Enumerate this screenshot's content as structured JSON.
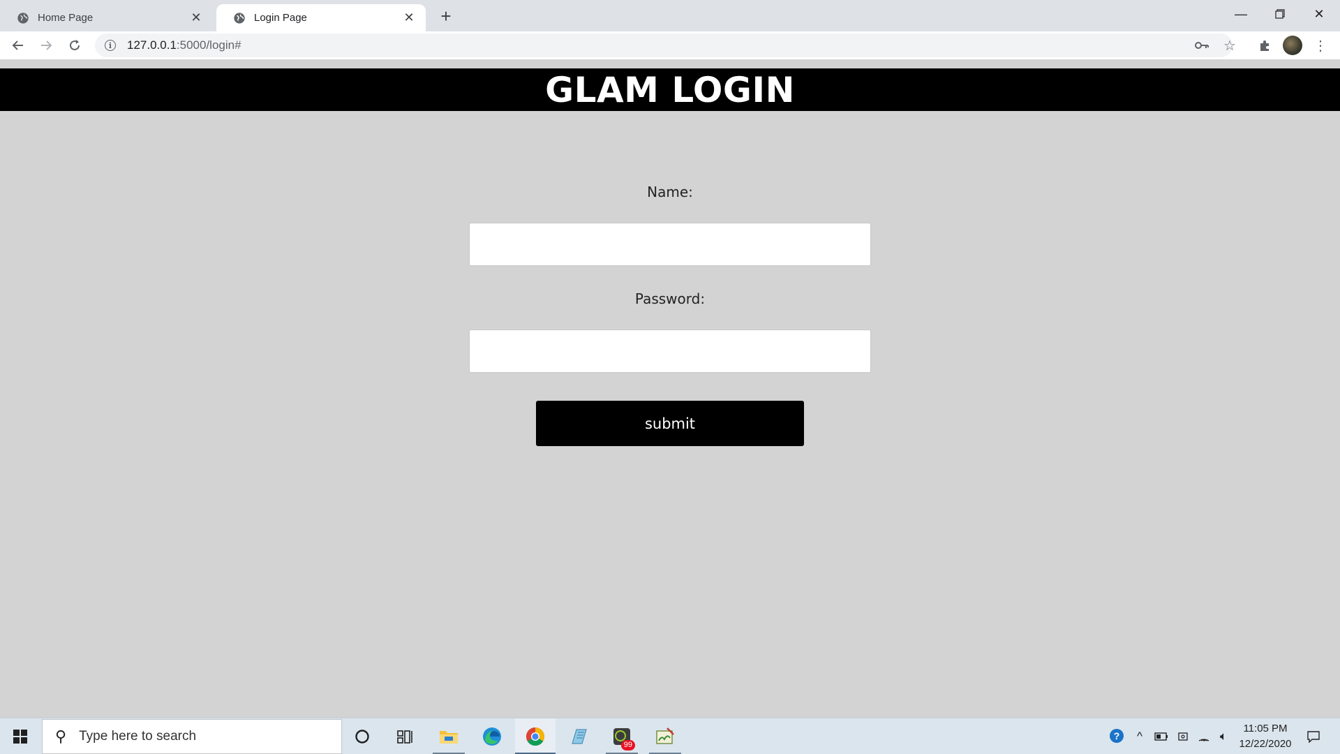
{
  "browser": {
    "tabs": [
      {
        "title": "Home Page",
        "active": false,
        "icon": "globe-icon"
      },
      {
        "title": "Login Page",
        "active": true,
        "icon": "globe-icon"
      }
    ],
    "new_tab_icon": "plus-icon",
    "url_host": "127.0.0.1",
    "url_path": ":5000/login#",
    "window_controls": [
      "minimize-icon",
      "restore-icon",
      "close-icon"
    ]
  },
  "page": {
    "title": "GLAM LOGIN",
    "name_label": "Name:",
    "password_label": "Password:",
    "name_value": "",
    "password_value": "",
    "submit_label": "submit",
    "background": "#d3d3d3",
    "header_color": "#000000"
  },
  "taskbar": {
    "search_placeholder": "Type here to search",
    "time": "11:05 PM",
    "date": "12/22/2020",
    "mail_badge": "99",
    "apps": [
      "cortana-icon",
      "task-view-icon",
      "file-explorer-icon",
      "edge-icon",
      "chrome-icon",
      "notepad-icon",
      "mail-icon",
      "paint-icon"
    ]
  }
}
